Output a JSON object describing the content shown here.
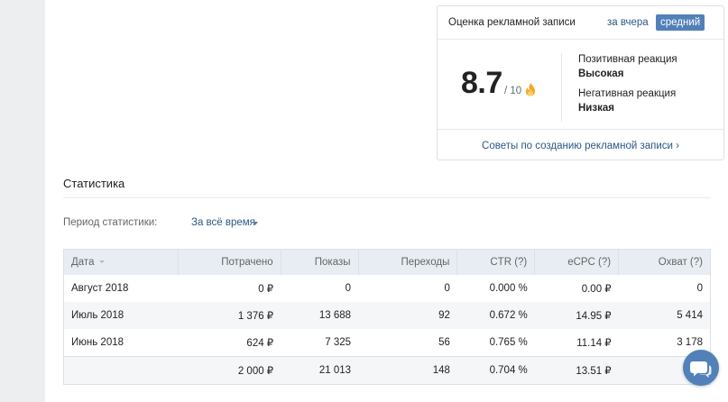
{
  "rating": {
    "title": "Оценка рекламной записи",
    "tab_yesterday": "за вчера",
    "tab_average": "средний",
    "score": "8.7",
    "out_of": "/ 10",
    "positive_label": "Позитивная реакция",
    "positive_value": "Высокая",
    "negative_label": "Негативная реакция",
    "negative_value": "Низкая",
    "tips_link": "Советы по созданию рекламной записи ›",
    "flame_icon": "flame-icon"
  },
  "stats": {
    "title": "Статистика",
    "period_label": "Период статистики:",
    "period_value": "За всё время",
    "columns": [
      "Дата",
      "Потрачено",
      "Показы",
      "Переходы",
      "CTR (?)",
      "eCPC (?)",
      "Охват (?)"
    ],
    "rows": [
      [
        "Август 2018",
        "0 ₽",
        "0",
        "0",
        "0.000 %",
        "0.00 ₽",
        "0"
      ],
      [
        "Июль 2018",
        "1 376 ₽",
        "13 688",
        "92",
        "0.672 %",
        "14.95 ₽",
        "5 414"
      ],
      [
        "Июнь 2018",
        "624 ₽",
        "7 325",
        "56",
        "0.765 %",
        "11.14 ₽",
        "3 178"
      ]
    ],
    "total": [
      "",
      "2 000 ₽",
      "21 013",
      "148",
      "0.704 %",
      "13.51 ₽",
      ""
    ]
  },
  "colors": {
    "accent": "#5181b8",
    "link": "#2a5885",
    "page_bg": "#edeef0"
  },
  "chat_button_icon": "chat-bubbles-icon"
}
